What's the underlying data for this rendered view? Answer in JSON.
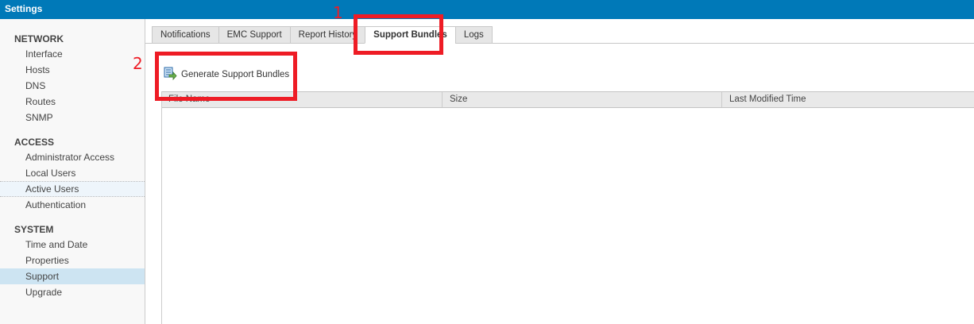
{
  "window": {
    "title": "Settings"
  },
  "sidebar": {
    "sections": [
      {
        "label": "NETWORK",
        "items": [
          "Interface",
          "Hosts",
          "DNS",
          "Routes",
          "SNMP"
        ]
      },
      {
        "label": "ACCESS",
        "items": [
          "Administrator Access",
          "Local Users",
          "Active Users",
          "Authentication"
        ]
      },
      {
        "label": "SYSTEM",
        "items": [
          "Time and Date",
          "Properties",
          "Support",
          "Upgrade"
        ]
      }
    ],
    "hovered": "Active Users",
    "selected": "Support"
  },
  "tabs": [
    "Notifications",
    "EMC Support",
    "Report History",
    "Support Bundles",
    "Logs"
  ],
  "active_tab": "Support Bundles",
  "toolbar": {
    "generate_label": "Generate Support Bundles"
  },
  "table": {
    "columns": [
      "File Name",
      "Size",
      "Last Modified Time"
    ],
    "rows": []
  },
  "annotations": {
    "step1": "1",
    "step2": "2",
    "color": "#ee1c25"
  }
}
